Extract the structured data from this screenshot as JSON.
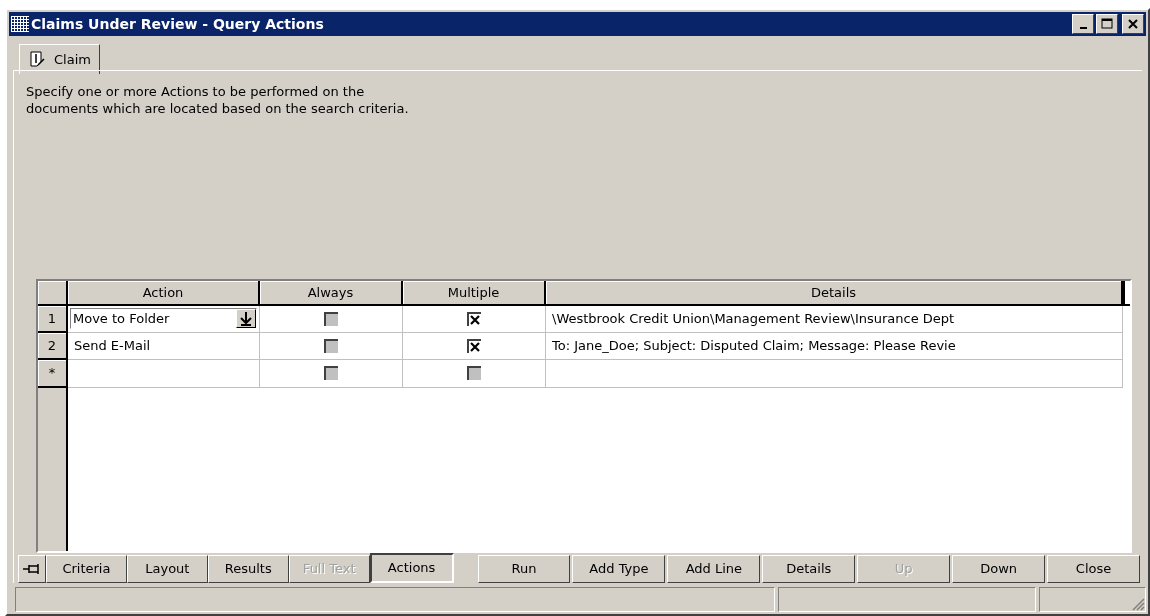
{
  "window": {
    "title": "Claims Under Review - Query Actions"
  },
  "tabs": [
    {
      "label": "Claim",
      "selected": true
    }
  ],
  "instructions": "Specify one or more Actions to be performed on the\ndocuments which are located based on the search criteria.",
  "grid": {
    "columns": [
      "Action",
      "Always",
      "Multiple",
      "Details"
    ],
    "rows": [
      {
        "row_header": "1",
        "kind": "dropdown",
        "action": "Move to Folder",
        "always": false,
        "multiple": true,
        "details": "\\Westbrook Credit Union\\Management Review\\Insurance Dept"
      },
      {
        "row_header": "2",
        "kind": "text",
        "action": "Send E-Mail",
        "always": false,
        "multiple": true,
        "details": "To: Jane_Doe; Subject: Disputed Claim; Message: Please Revie"
      },
      {
        "row_header": "*",
        "kind": "text",
        "always": false,
        "multiple": false
      }
    ]
  },
  "view_tabs": [
    {
      "label": "Criteria",
      "selected": false,
      "disabled": false
    },
    {
      "label": "Layout",
      "selected": false,
      "disabled": false
    },
    {
      "label": "Results",
      "selected": false,
      "disabled": false
    },
    {
      "label": "Full Text",
      "selected": false,
      "disabled": true
    },
    {
      "label": "Actions",
      "selected": true,
      "disabled": false
    }
  ],
  "buttons": [
    {
      "label": "Run",
      "disabled": false
    },
    {
      "label": "Add Type",
      "disabled": false
    },
    {
      "label": "Add Line",
      "disabled": false
    },
    {
      "label": "Details",
      "disabled": false
    },
    {
      "label": "Up",
      "disabled": true
    },
    {
      "label": "Down",
      "disabled": false
    },
    {
      "label": "Close",
      "disabled": false
    }
  ]
}
